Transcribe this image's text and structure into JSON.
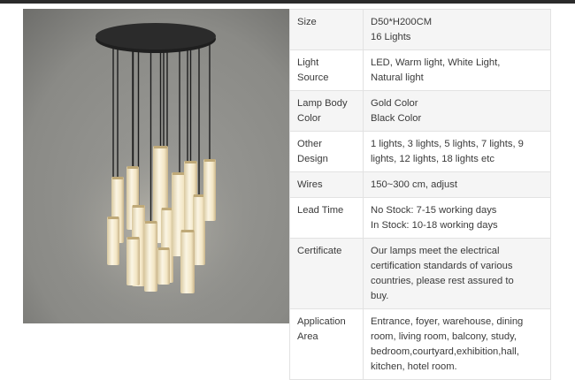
{
  "photo": {
    "subject": "pendant-chandelier-image",
    "colors": {
      "wall": "#8d8d89",
      "canopy": "#262626",
      "glow": "#f7edd2"
    }
  },
  "specs": [
    {
      "key": [
        "Size"
      ],
      "value": [
        "D50*H200CM",
        "16 Lights"
      ]
    },
    {
      "key": [
        "Light",
        "Source"
      ],
      "value": [
        "LED, Warm light, White Light,",
        "Natural light"
      ]
    },
    {
      "key": [
        "Lamp Body",
        "Color"
      ],
      "value": [
        "Gold Color",
        "Black Color"
      ]
    },
    {
      "key": [
        "Other",
        "Design"
      ],
      "value": [
        "1 lights, 3 lights, 5 lights, 7 lights, 9",
        "lights, 12 lights, 18 lights etc"
      ]
    },
    {
      "key": [
        "Wires"
      ],
      "value": [
        "150~300 cm, adjust"
      ]
    },
    {
      "key": [
        "Lead Time"
      ],
      "value": [
        "No Stock: 7-15 working days",
        "In Stock: 10-18 working days"
      ]
    },
    {
      "key": [
        "Certificate"
      ],
      "value": [
        "Our lamps meet the electrical",
        "certification standards of various",
        "countries, please rest assured to",
        "buy."
      ]
    },
    {
      "key": [
        "Application",
        "Area"
      ],
      "value": [
        "Entrance, foyer, warehouse, dining",
        "room, living room, balcony, study,",
        "bedroom,courtyard,exhibition,hall,",
        "kitchen, hotel room."
      ]
    }
  ]
}
